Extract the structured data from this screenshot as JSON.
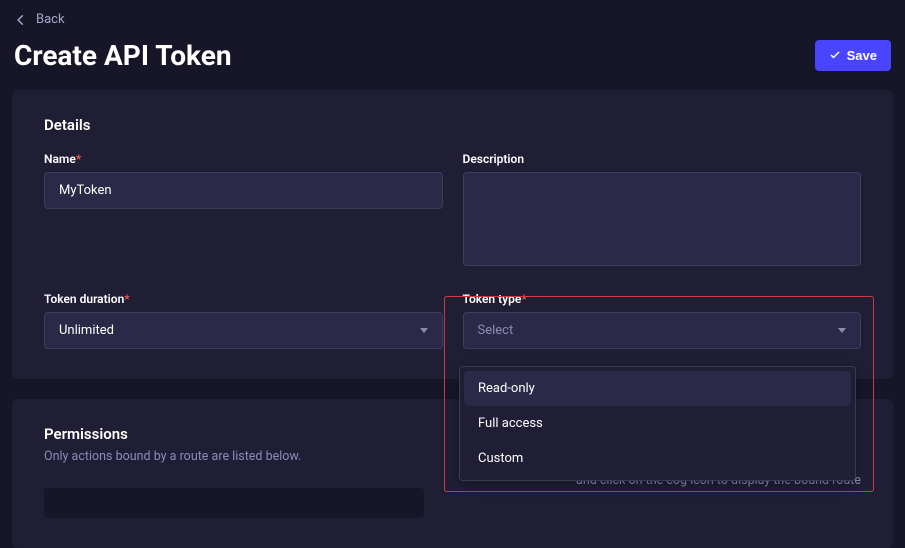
{
  "nav": {
    "back": "Back"
  },
  "page": {
    "title": "Create API Token"
  },
  "actions": {
    "save": "Save"
  },
  "details": {
    "section_title": "Details",
    "name_label": "Name",
    "name_value": "MyToken",
    "description_label": "Description",
    "description_value": "",
    "duration_label": "Token duration",
    "duration_value": "Unlimited",
    "type_label": "Token type",
    "type_placeholder": "Select",
    "type_options": [
      "Read-only",
      "Full access",
      "Custom"
    ]
  },
  "permissions": {
    "section_title": "Permissions",
    "subtitle": "Only actions bound by a route are listed below.",
    "hint": "and click on the cog icon to display the bound route"
  }
}
